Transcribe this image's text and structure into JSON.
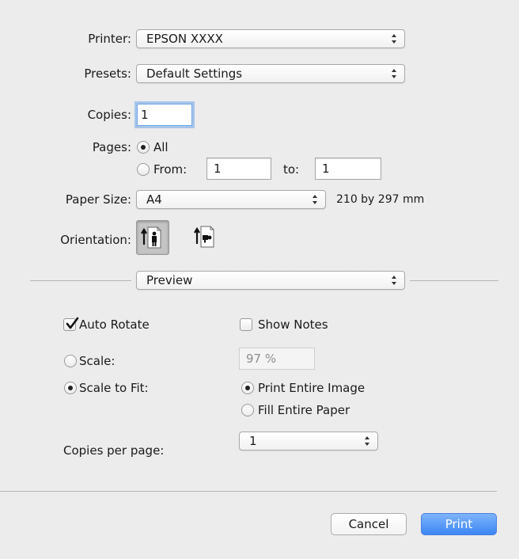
{
  "printer": {
    "label": "Printer:",
    "value": "EPSON XXXX"
  },
  "presets": {
    "label": "Presets:",
    "value": "Default Settings"
  },
  "copies": {
    "label": "Copies:",
    "value": "1"
  },
  "pages": {
    "label": "Pages:",
    "all_label": "All",
    "from_label": "From:",
    "from_value": "1",
    "to_label": "to:",
    "to_value": "1",
    "selected": "All"
  },
  "paper_size": {
    "label": "Paper Size:",
    "value": "A4",
    "dimensions": "210 by 297 mm"
  },
  "orientation": {
    "label": "Orientation:",
    "selected": "portrait",
    "icons": [
      "portrait-orientation-icon",
      "landscape-orientation-icon"
    ]
  },
  "section": {
    "value": "Preview"
  },
  "preview": {
    "auto_rotate": {
      "label": "Auto Rotate",
      "checked": true
    },
    "show_notes": {
      "label": "Show Notes",
      "checked": false
    },
    "scale": {
      "label": "Scale:",
      "value": "97 %",
      "selected": false
    },
    "scale_to_fit": {
      "label": "Scale to Fit:",
      "selected": true
    },
    "print_entire_image": {
      "label": "Print Entire Image",
      "selected": true
    },
    "fill_entire_paper": {
      "label": "Fill Entire Paper",
      "selected": false
    },
    "copies_per_page": {
      "label": "Copies per page:",
      "value": "1"
    }
  },
  "buttons": {
    "cancel": "Cancel",
    "print": "Print"
  },
  "colors": {
    "accent": "#3c86f4",
    "background": "#ececec"
  }
}
